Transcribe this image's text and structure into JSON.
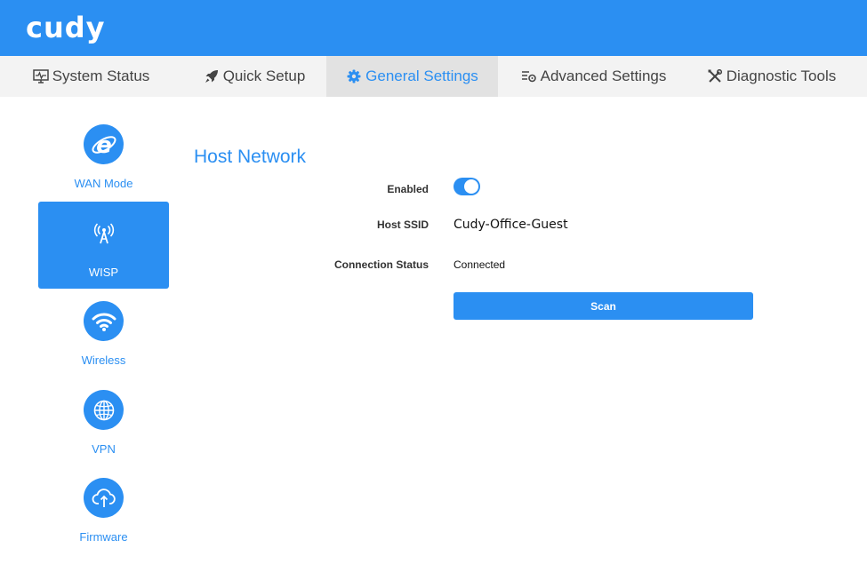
{
  "brand": {
    "logo_text": "cudy",
    "primary_color": "#2b8ff2"
  },
  "nav": {
    "tabs": [
      {
        "label": "System Status",
        "icon": "monitor-pulse-icon",
        "active": false
      },
      {
        "label": "Quick Setup",
        "icon": "rocket-icon",
        "active": false
      },
      {
        "label": "General Settings",
        "icon": "gear-icon",
        "active": true
      },
      {
        "label": "Advanced Settings",
        "icon": "list-gear-icon",
        "active": false
      },
      {
        "label": "Diagnostic Tools",
        "icon": "tools-icon",
        "active": false
      }
    ]
  },
  "sidebar": {
    "items": [
      {
        "label": "WAN Mode",
        "icon": "internet-explorer-icon",
        "active": false
      },
      {
        "label": "WISP",
        "icon": "antenna-icon",
        "active": true
      },
      {
        "label": "Wireless",
        "icon": "wifi-icon",
        "active": false
      },
      {
        "label": "VPN",
        "icon": "globe-icon",
        "active": false
      },
      {
        "label": "Firmware",
        "icon": "cloud-upload-icon",
        "active": false
      }
    ]
  },
  "main": {
    "title": "Host Network",
    "enabled": {
      "label": "Enabled",
      "value": true
    },
    "host_ssid": {
      "label": "Host SSID",
      "value": "Cudy-Office-Guest"
    },
    "connection_status": {
      "label": "Connection Status",
      "value": "Connected"
    },
    "scan_label": "Scan"
  }
}
